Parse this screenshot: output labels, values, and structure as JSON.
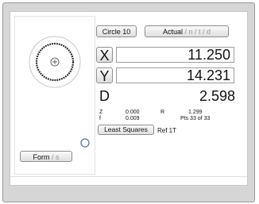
{
  "feature_button": {
    "label": "Circle 10"
  },
  "mode_button": {
    "label": "Actual",
    "options": " / n / t / d"
  },
  "readouts": [
    {
      "axis": "X",
      "value": "11.250"
    },
    {
      "axis": "Y",
      "value": "14.231"
    },
    {
      "axis": "D",
      "value": "2.598"
    }
  ],
  "stats": {
    "z_label": "Z",
    "z_value": "0.000",
    "r_label": "R",
    "r_value": "1.299",
    "f_label": "f",
    "f_value": "0.009",
    "points": "Pts 33 of 33"
  },
  "fit_button": {
    "label": "Least Squares"
  },
  "reference": "Ref 1T",
  "form_button": {
    "label": "Form",
    "options": " / s"
  },
  "colors": {
    "indicator_ring": "#4a6fb0",
    "accent": "#222222"
  },
  "icons": {
    "indicator": "circle-indicator-icon",
    "crosshair": "crosshair-icon"
  }
}
